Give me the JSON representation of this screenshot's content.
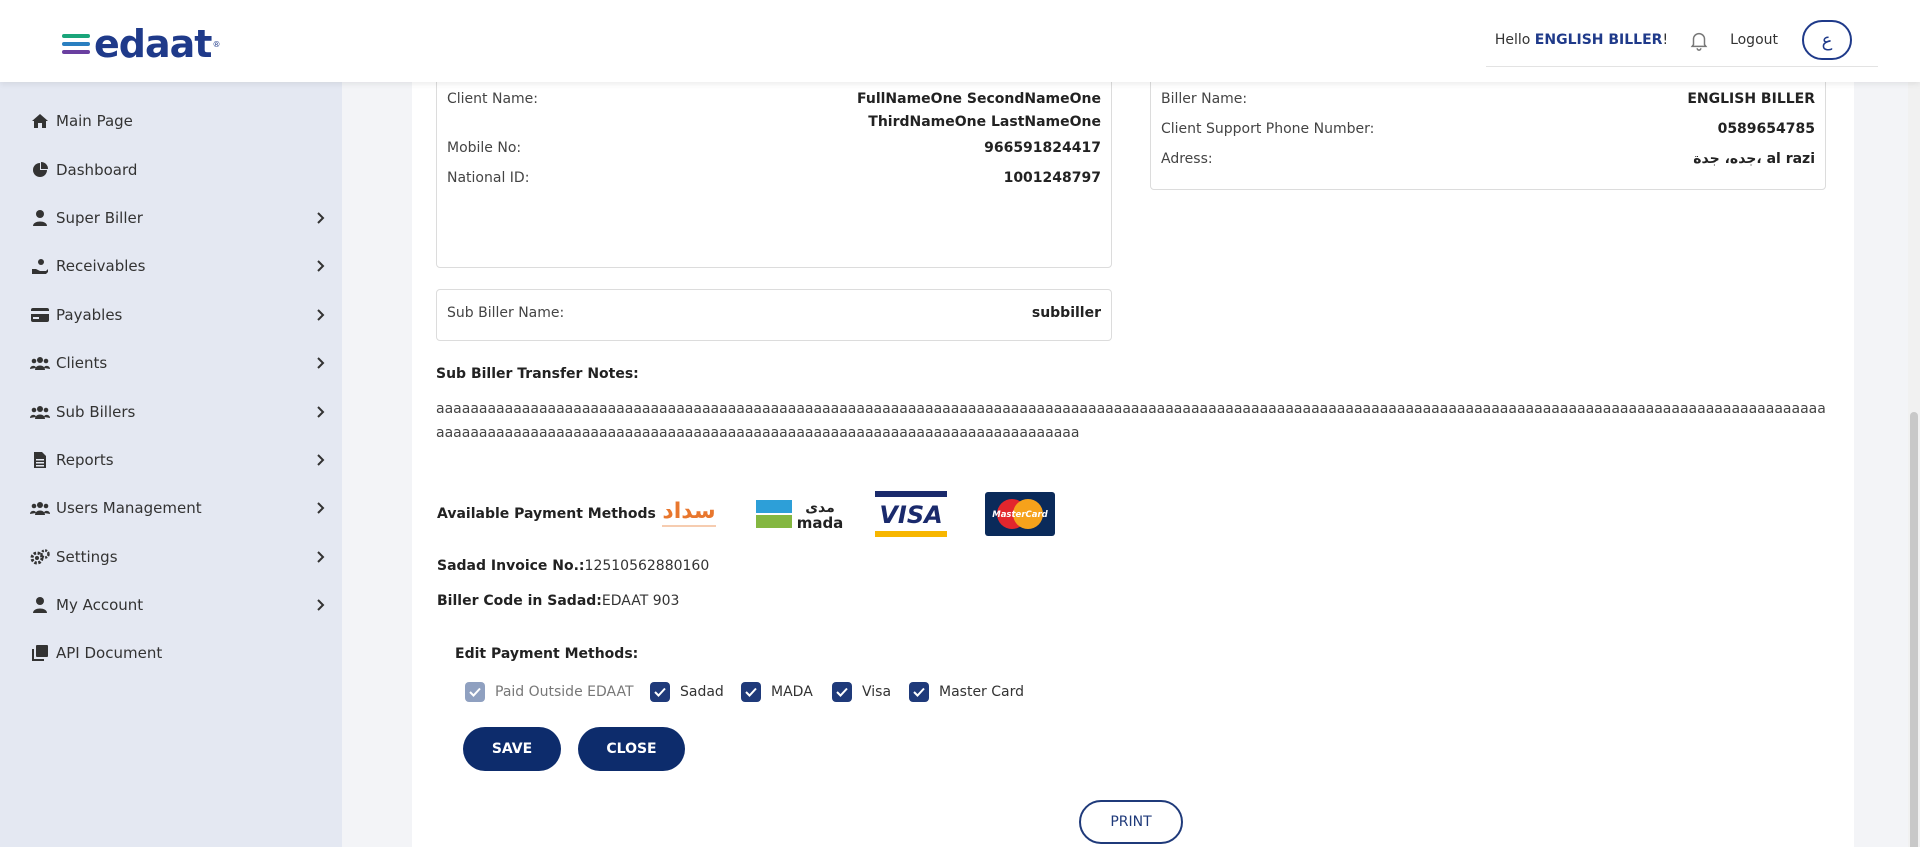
{
  "header": {
    "logo_text": "edaat",
    "logo_tm": "®",
    "greeting_prefix": "Hello ",
    "user_name": "ENGLISH BILLER",
    "greeting_suffix": "!",
    "logout_label": "Logout",
    "language_button": "ع"
  },
  "sidebar": {
    "items": [
      {
        "label": "Main Page",
        "icon": "home-icon",
        "has_chevron": false
      },
      {
        "label": "Dashboard",
        "icon": "pie-chart-icon",
        "has_chevron": false
      },
      {
        "label": "Super Biller",
        "icon": "user-icon",
        "has_chevron": true
      },
      {
        "label": "Receivables",
        "icon": "hand-money-icon",
        "has_chevron": true
      },
      {
        "label": "Payables",
        "icon": "credit-card-icon",
        "has_chevron": true
      },
      {
        "label": "Clients",
        "icon": "users-icon",
        "has_chevron": true
      },
      {
        "label": "Sub Billers",
        "icon": "users-icon",
        "has_chevron": true
      },
      {
        "label": "Reports",
        "icon": "document-icon",
        "has_chevron": true
      },
      {
        "label": "Users Management",
        "icon": "users-icon",
        "has_chevron": true
      },
      {
        "label": "Settings",
        "icon": "gears-icon",
        "has_chevron": true
      },
      {
        "label": "My Account",
        "icon": "user-icon",
        "has_chevron": true
      },
      {
        "label": "API Document",
        "icon": "copy-icon",
        "has_chevron": false
      }
    ]
  },
  "client": {
    "name_label": "Client Name:",
    "name_line1": "FullNameOne SecondNameOne",
    "name_line2": "ThirdNameOne LastNameOne",
    "mobile_label": "Mobile No:",
    "mobile_value": "966591824417",
    "national_id_label": "National ID:",
    "national_id_value": "1001248797"
  },
  "biller": {
    "name_label": "Biller Name:",
    "name_value": "ENGLISH BILLER",
    "support_label": "Client Support Phone Number:",
    "support_value": "0589654785",
    "address_label": "Adress:",
    "address_value": "al razi ،جده، جدة"
  },
  "sub_biller": {
    "name_label": "Sub Biller Name:",
    "name_value": "subbiller"
  },
  "notes": {
    "title": "Sub Biller Transfer Notes:",
    "text": "aaaaaaaaaaaaaaaaaaaaaaaaaaaaaaaaaaaaaaaaaaaaaaaaaaaaaaaaaaaaaaaaaaaaaaaaaaaaaaaaaaaaaaaaaaaaaaaaaaaaaaaaaaaaaaaaaaaaaaaaaaaaaaaaaaaaaaaaaaaaaaaaaaaaaaaaaaaaaaaaaaaaaaaaaaaaaaaaaaaaaaaaaaaaaaaaaaaaaaaaaaaaaaaaaaaaaaaaaaaaaaaaaaaaaaaaaaaaa"
  },
  "payment_methods": {
    "title": "Available Payment Methods",
    "sadad_logo": "سداد",
    "mada_logo_ar": "مدى",
    "mada_logo_en": "mada",
    "visa_logo": "VISA",
    "mastercard_logo": "MasterCard"
  },
  "invoice": {
    "sadad_invoice_label": "Sadad Invoice No.:",
    "sadad_invoice_value": "12510562880160",
    "biller_code_label": "Biller Code in Sadad:",
    "biller_code_value": "EDAAT 903"
  },
  "edit_methods": {
    "title": "Edit Payment Methods:",
    "options": [
      {
        "label": "Paid Outside EDAAT",
        "checked": true,
        "disabled": true
      },
      {
        "label": "Sadad",
        "checked": true,
        "disabled": false
      },
      {
        "label": "MADA",
        "checked": true,
        "disabled": false
      },
      {
        "label": "Visa",
        "checked": true,
        "disabled": false
      },
      {
        "label": "Master Card",
        "checked": true,
        "disabled": false
      }
    ],
    "save_label": "SAVE",
    "close_label": "CLOSE"
  },
  "print_label": "PRINT",
  "colors": {
    "brand_navy": "#0d2c6c",
    "sidebar_bg": "#e4e8f2"
  }
}
